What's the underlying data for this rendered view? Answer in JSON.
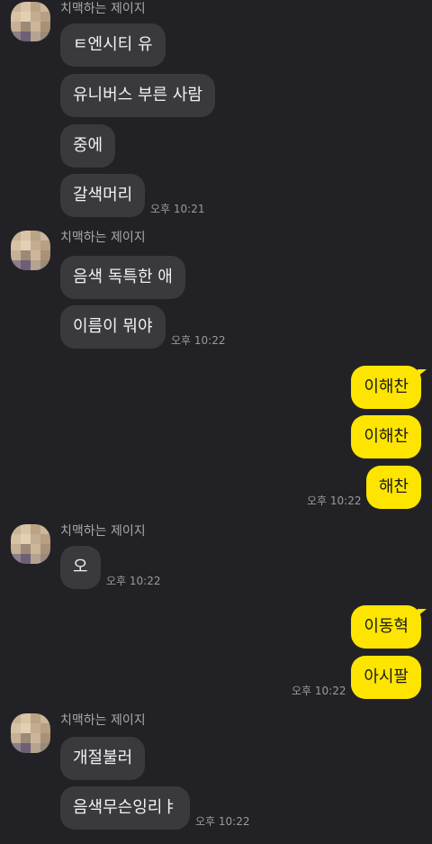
{
  "sender_name": "치맥하는 제이지",
  "groups": [
    {
      "side": "in",
      "messages": [
        "ㅌ엔시티 유",
        "유니버스 부른 사람",
        "중에",
        "갈색머리"
      ],
      "time": "오후 10:21"
    },
    {
      "side": "in",
      "messages": [
        "음색 독특한 애",
        "이름이 뭐야"
      ],
      "time": "오후 10:22"
    },
    {
      "side": "out",
      "messages": [
        "이해찬",
        "이해찬",
        "해찬"
      ],
      "time": "오후 10:22"
    },
    {
      "side": "in",
      "messages": [
        "오"
      ],
      "time": "오후 10:22"
    },
    {
      "side": "out",
      "messages": [
        "이동혁",
        "아시팔"
      ],
      "time": "오후 10:22"
    },
    {
      "side": "in",
      "messages": [
        "개절불러",
        "음색무슨잉리ㅑ"
      ],
      "time": "오후 10:22"
    }
  ],
  "colors": {
    "background": "#222226",
    "incoming_bubble": "#3a3a3e",
    "outgoing_bubble": "#fee500"
  }
}
